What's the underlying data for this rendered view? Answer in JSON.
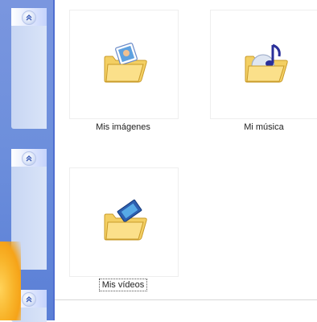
{
  "colors": {
    "task_pane": "#6d8fdc",
    "pane_section": "#d3dff7",
    "accent_start": "#f6a318"
  },
  "task_pane": {
    "sections": [
      {
        "button_icon": "chevron-up-double-icon"
      },
      {
        "button_icon": "chevron-up-double-icon"
      },
      {
        "button_icon": "chevron-up-double-icon"
      }
    ]
  },
  "folders": [
    {
      "label": "Mis imágenes",
      "icon": "pictures-folder-icon",
      "selected": false
    },
    {
      "label": "Mi música",
      "icon": "music-folder-icon",
      "selected": false
    },
    {
      "label": "Mis vídeos",
      "icon": "videos-folder-icon",
      "selected": true
    }
  ]
}
